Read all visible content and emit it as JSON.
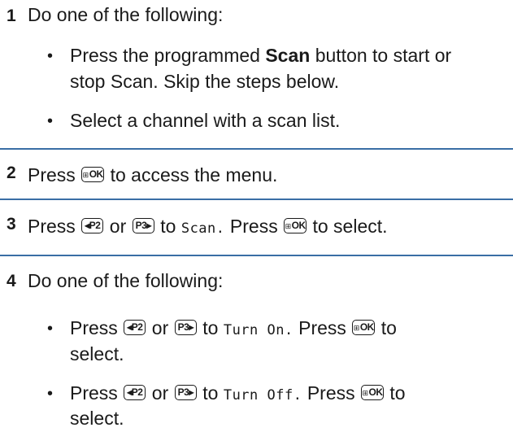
{
  "steps": [
    {
      "number": "1",
      "text": "Do one of the following:",
      "bullets": [
        {
          "pre": "Press the programmed ",
          "bold": "Scan",
          "post": " button to start or",
          "line2": "stop Scan. Skip the steps below."
        },
        {
          "text": "Select a channel with a scan list."
        }
      ]
    },
    {
      "number": "2",
      "pre": "Press",
      "post": "to access the menu."
    },
    {
      "number": "3",
      "pre": "Press",
      "or": "or",
      "to": "to",
      "menu": "Scan.",
      "mid": "Press",
      "post": "to select."
    },
    {
      "number": "4",
      "text": "Do one of the following:",
      "bullets": [
        {
          "pre": "Press",
          "or": "or",
          "to": "to",
          "menu": "Turn On.",
          "mid": "Press",
          "post": "to",
          "line2": "select."
        },
        {
          "pre": "Press",
          "or": "or",
          "to": "to",
          "menu": "Turn Off.",
          "mid": "Press",
          "post": "to",
          "line2": "select."
        }
      ]
    }
  ],
  "keys": {
    "ok_grid": "⊞",
    "ok": "OK",
    "p2_arrow": "◂",
    "p2": "P2",
    "p3": "P3",
    "p3_arrow": "▸"
  },
  "bullet_char": "•",
  "accent_color": "#3a6ea5"
}
